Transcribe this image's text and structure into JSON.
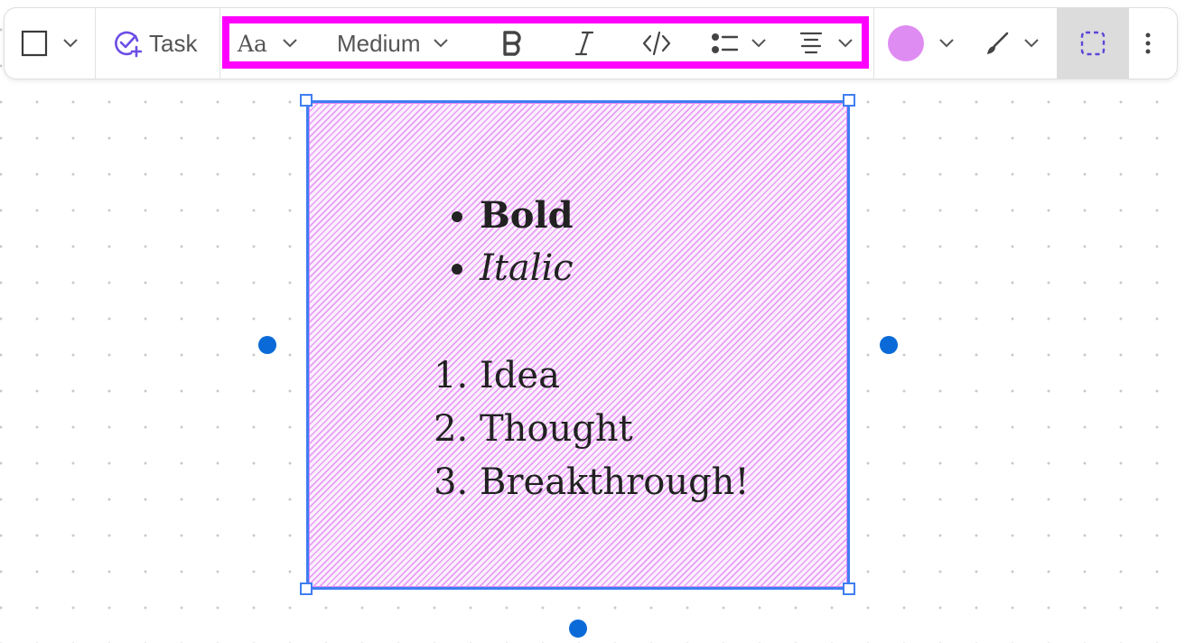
{
  "toolbar": {
    "shape_tool": {
      "icon": "square-icon"
    },
    "task_label": "Task",
    "font_label": "Aa",
    "size_label": "Medium",
    "bold_icon": "bold-icon",
    "italic_icon": "italic-icon",
    "code_icon": "code-icon",
    "list_icon": "bullet-list-icon",
    "align_icon": "align-center-icon",
    "color": "#df8cf2",
    "highlight_color": "#ff00ff",
    "select_tool_active": true
  },
  "note": {
    "fill_color": "#df8cf2",
    "bullets": [
      "Bold",
      "Italic"
    ],
    "numbered": [
      "Idea",
      "Thought",
      "Breakthrough!"
    ]
  },
  "selection_color": "#3f7ef2",
  "connector_color": "#0a6ad8"
}
